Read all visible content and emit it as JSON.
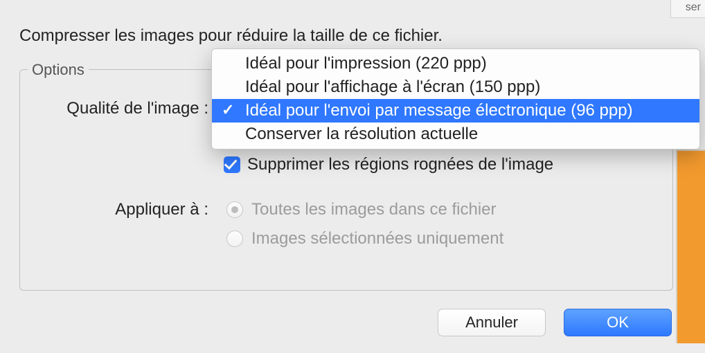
{
  "title": "Compresser les images pour réduire la taille de ce fichier.",
  "fieldset_label": "Options",
  "quality_label": "Qualité de l'image :",
  "dropdown": {
    "items": [
      "Idéal pour l'impression (220 ppp)",
      "Idéal pour l'affichage à l'écran (150 ppp)",
      "Idéal pour l'envoi par message électronique (96 ppp)",
      "Conserver la résolution actuelle"
    ],
    "selected_index": 2
  },
  "checkbox_label": "Supprimer les régions rognées de l'image",
  "checkbox_checked": true,
  "apply_label": "Appliquer à :",
  "radios": [
    {
      "label": "Toutes les images dans ce fichier",
      "selected": true
    },
    {
      "label": "Images sélectionnées uniquement",
      "selected": false
    }
  ],
  "buttons": {
    "cancel": "Annuler",
    "ok": "OK"
  },
  "window_frag": "ser"
}
